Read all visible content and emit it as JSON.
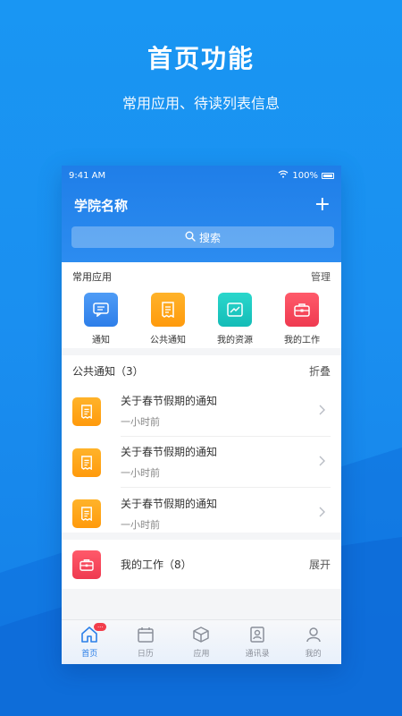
{
  "hero": {
    "title": "首页功能",
    "subtitle": "常用应用、待读列表信息"
  },
  "status_bar": {
    "time": "9:41 AM",
    "battery": "100%"
  },
  "header": {
    "title": "学院名称",
    "add_label": "+",
    "search_label": "搜索"
  },
  "common_apps": {
    "title": "常用应用",
    "action": "管理",
    "items": [
      {
        "label": "通知",
        "icon": "chat-icon",
        "color": "#3a8cf0"
      },
      {
        "label": "公共通知",
        "icon": "receipt-icon",
        "color": "#ffa61a"
      },
      {
        "label": "我的资源",
        "icon": "chart-icon",
        "color": "#1ec9c1"
      },
      {
        "label": "我的工作",
        "icon": "briefcase-icon",
        "color": "#f5475a"
      }
    ]
  },
  "public_notices": {
    "title": "公共通知（3）",
    "action": "折叠",
    "items": [
      {
        "title": "关于春节假期的通知",
        "time": "一小时前"
      },
      {
        "title": "关于春节假期的通知",
        "time": "一小时前"
      },
      {
        "title": "关于春节假期的通知",
        "time": "一小时前"
      }
    ]
  },
  "my_work": {
    "title": "我的工作（8）",
    "action": "展开"
  },
  "tabs": [
    {
      "label": "首页",
      "icon": "home-icon",
      "active": true,
      "badge": "..."
    },
    {
      "label": "日历",
      "icon": "calendar-icon",
      "active": false
    },
    {
      "label": "应用",
      "icon": "cube-icon",
      "active": false
    },
    {
      "label": "通讯录",
      "icon": "contacts-icon",
      "active": false
    },
    {
      "label": "我的",
      "icon": "person-icon",
      "active": false
    }
  ],
  "colors": {
    "background": "#1a8ff0",
    "header_blue": "#2484ec",
    "active_tab": "#2b7fe8"
  }
}
